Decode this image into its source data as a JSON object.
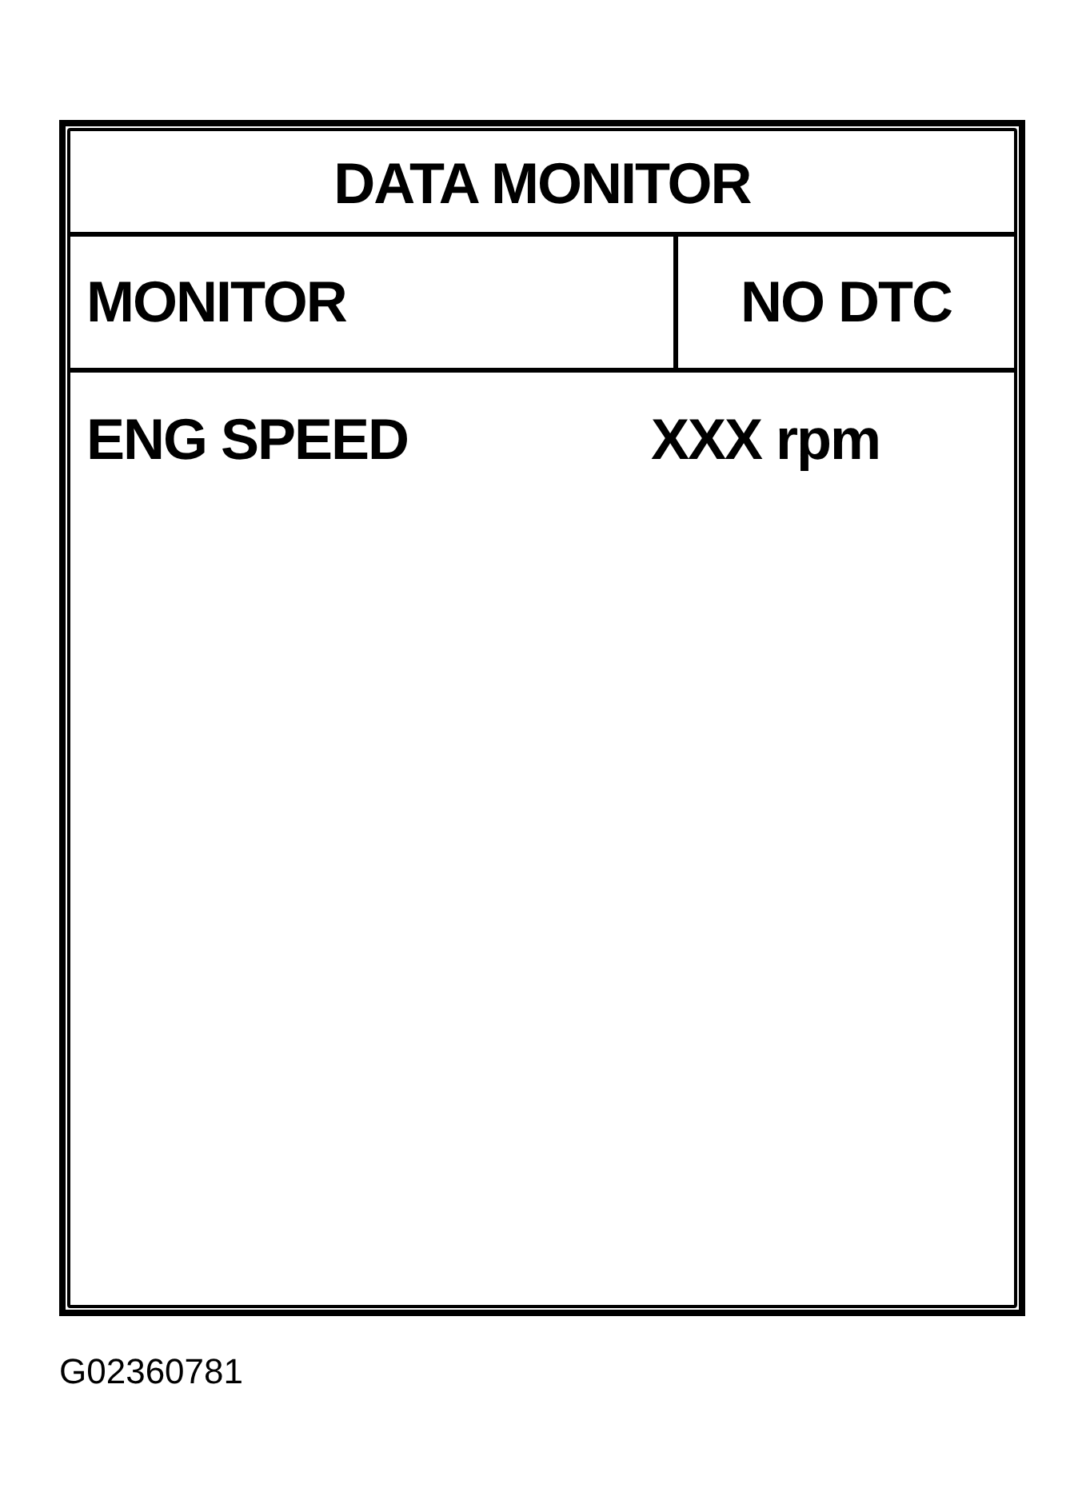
{
  "title": "DATA MONITOR",
  "header": {
    "mode": "MONITOR",
    "status": "NO DTC"
  },
  "rows": [
    {
      "label": "ENG SPEED",
      "value": "XXX rpm"
    }
  ],
  "figure_id": "G02360781"
}
